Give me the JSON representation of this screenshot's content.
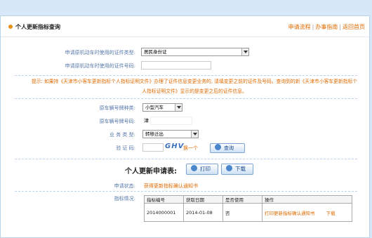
{
  "header": {
    "title": "个人更新指标查询",
    "links": [
      "申请流程",
      "办事指南",
      "返回首页"
    ]
  },
  "form": {
    "doc_type_label": "申请原机动车时使用的证件类型:",
    "doc_type_value": "居民身份证",
    "doc_no_label": "申请原机动车时使用的证件号码:",
    "hint": "提示: 如果持《天津市小客车更新指标个人指标证明文件》办理了证件信息变更业务的, 请填变更之前的证件及号码。查询到的新《天津市小客车更新指标个人指标证明文件》显示的是变更之后的证件信息。",
    "plate_type_label": "原车辆号牌种类:",
    "plate_type_value": "小型汽车",
    "plate_no_label": "原车辆号牌号码:",
    "plate_prefix": "津",
    "biz_type_label": "业 务 类 型:",
    "biz_type_value": "转移迁出",
    "captcha_label": "验 证 码:",
    "captcha_text": "GHV",
    "refresh_label": "换一个",
    "query_label": "查询"
  },
  "result": {
    "title": "个人更新申请表:",
    "print_label": "打印",
    "download_label": "下载",
    "status_label": "申请状态:",
    "status_value": "获得更新指标确认通知书",
    "quota_label": "指标情况:",
    "columns": [
      "指标编号",
      "获取日期",
      "是否使用",
      "操作"
    ],
    "rows": [
      {
        "id": "2014000001",
        "date": "2014-01-08",
        "used": "否",
        "op_print": "打印更新指标确认通知书",
        "op_download": "下载"
      }
    ]
  },
  "colors": {
    "accent": "#e06a00",
    "label": "#5577aa",
    "frame": "#b9d3ea",
    "bg": "#d7e9f8"
  }
}
